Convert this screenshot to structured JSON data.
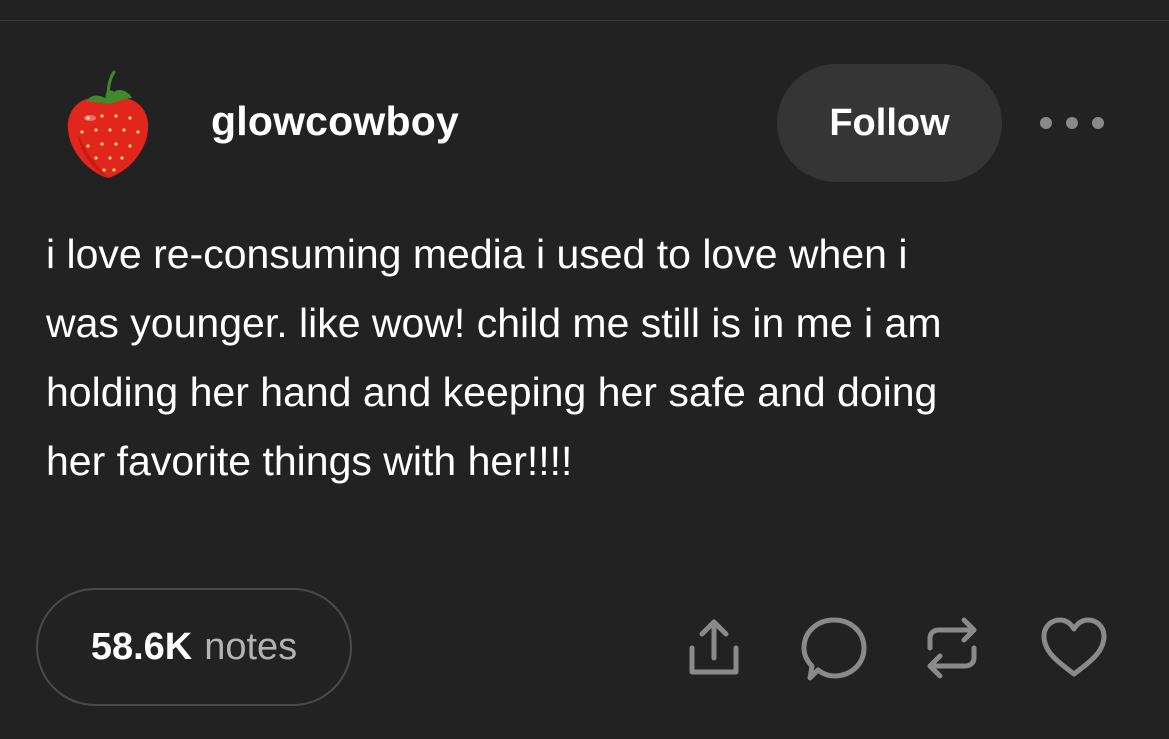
{
  "post": {
    "username": "glowcowboy",
    "follow_label": "Follow",
    "more_icon": "more-horizontal-icon",
    "avatar_icon": "strawberry-avatar",
    "body_lines": [
      "i love re-consuming media i used to love when i",
      "was younger. like wow! child me still is in me i am",
      "holding her hand and keeping her safe and doing",
      "her favorite things with her!!!!"
    ]
  },
  "footer": {
    "notes_count": "58.6K",
    "notes_label": "notes",
    "actions": [
      "share-icon",
      "reply-icon",
      "reblog-icon",
      "like-icon"
    ]
  },
  "colors": {
    "background": "#222222",
    "button_bg": "#353535",
    "icon_gray": "#8a8a8a",
    "text": "#ffffff",
    "muted_text": "#b3b3b3"
  }
}
